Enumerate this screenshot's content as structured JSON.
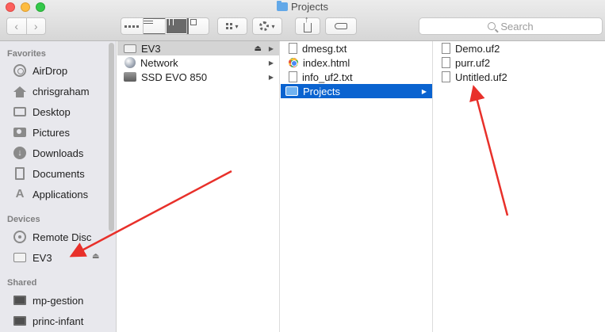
{
  "window": {
    "title": "Projects"
  },
  "toolbar": {
    "back_glyph": "‹",
    "forward_glyph": "›",
    "search_placeholder": "Search",
    "caret": "▾"
  },
  "sidebar": {
    "favorites_heading": "Favorites",
    "favorites": [
      {
        "label": "AirDrop",
        "icon": "airdrop-icon"
      },
      {
        "label": "chrisgraham",
        "icon": "home-icon"
      },
      {
        "label": "Desktop",
        "icon": "desktop-icon"
      },
      {
        "label": "Pictures",
        "icon": "camera-icon"
      },
      {
        "label": "Downloads",
        "icon": "download-icon"
      },
      {
        "label": "Documents",
        "icon": "document-icon"
      },
      {
        "label": "Applications",
        "icon": "applications-icon"
      }
    ],
    "devices_heading": "Devices",
    "devices": [
      {
        "label": "Remote Disc",
        "icon": "disc-icon"
      },
      {
        "label": "EV3",
        "icon": "drive-icon"
      }
    ],
    "shared_heading": "Shared",
    "shared": [
      {
        "label": "mp-gestion",
        "icon": "monitor-icon"
      },
      {
        "label": "princ-infant",
        "icon": "monitor-icon"
      }
    ],
    "eject_glyph": "⏏"
  },
  "columns": {
    "col1": [
      {
        "label": "EV3",
        "icon": "drive-icon"
      },
      {
        "label": "Network",
        "icon": "globe-icon"
      },
      {
        "label": "SSD EVO 850",
        "icon": "ssd-icon"
      }
    ],
    "col2": [
      {
        "label": "dmesg.txt",
        "icon": "file-icon"
      },
      {
        "label": "index.html",
        "icon": "html-file-icon"
      },
      {
        "label": "info_uf2.txt",
        "icon": "file-icon"
      },
      {
        "label": "Projects",
        "icon": "folder-icon"
      }
    ],
    "col3": [
      {
        "label": "Demo.uf2",
        "icon": "file-icon"
      },
      {
        "label": "purr.uf2",
        "icon": "file-icon"
      },
      {
        "label": "Untitled.uf2",
        "icon": "file-icon"
      }
    ],
    "chevron": "▶",
    "eject_glyph": "⏏"
  },
  "colors": {
    "selection_blue": "#0a63d0",
    "selection_grey": "#d4d4d4",
    "annotation_red": "#e8302a"
  }
}
